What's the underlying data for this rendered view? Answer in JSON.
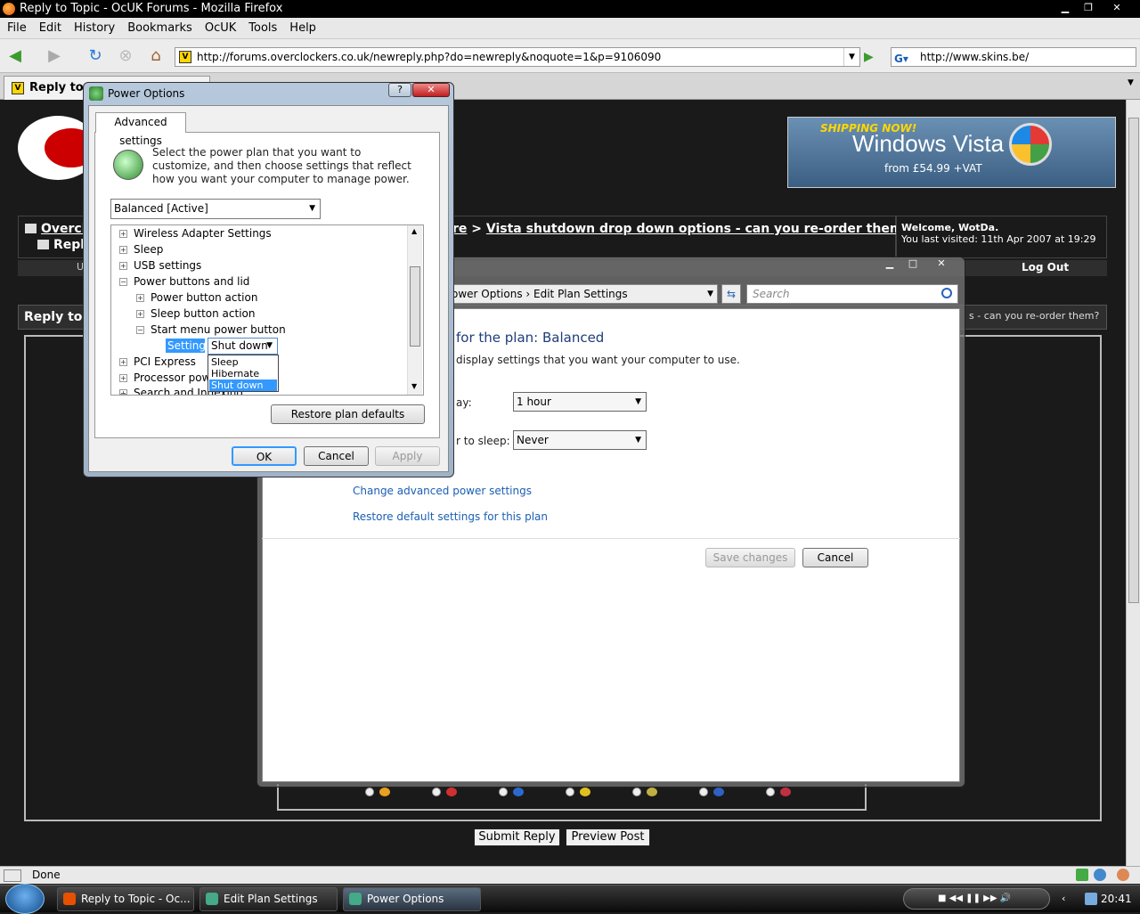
{
  "firefox": {
    "title": "Reply to Topic - OcUK Forums - Mozilla Firefox",
    "menu": [
      "File",
      "Edit",
      "History",
      "Bookmarks",
      "OcUK",
      "Tools",
      "Help"
    ],
    "url": "http://forums.overclockers.co.uk/newreply.php?do=newreply&noquote=1&p=9106090",
    "search_value": "http://www.skins.be/",
    "tab_label": "Reply to To",
    "status": "Done"
  },
  "page": {
    "banner": {
      "line1": "SHIPPING NOW!",
      "line2": "Windows Vista",
      "line3": "from £54.99 +VAT"
    },
    "breadcrumb1": "Overcl",
    "breadcrumb2": "Repl",
    "thread_prefix": "re",
    "thread_title": "Vista shutdown drop down options - can you re-order them?",
    "welcome_line1": "Welcome, WotDa.",
    "welcome_line2": "You last visited: 11th Apr 2007 at 19:29",
    "nav_u": "U",
    "logout": "Log Out",
    "reply_header": "Reply to T",
    "reply_header_right": "s - can you re-order them?",
    "submit_reply": "Submit Reply",
    "preview_post": "Preview Post"
  },
  "edit_plan": {
    "address": "ower Options  ›  Edit Plan Settings",
    "search_placeholder": "Search",
    "heading": "for the plan: Balanced",
    "subheading": "display settings that you want your computer to use.",
    "label1": "ay:",
    "label2": "r to sleep:",
    "display_value": "1 hour",
    "sleep_value": "Never",
    "link_advanced": "Change advanced power settings",
    "link_restore": "Restore default settings for this plan",
    "save_changes": "Save changes",
    "cancel": "Cancel"
  },
  "power_options": {
    "title": "Power Options",
    "tab": "Advanced settings",
    "description": "Select the power plan that you want to customize, and then choose settings that reflect how you want your computer to manage power.",
    "plan": "Balanced [Active]",
    "tree": {
      "wireless": "Wireless Adapter Settings",
      "sleep": "Sleep",
      "usb": "USB settings",
      "power_buttons": "Power buttons and lid",
      "power_button_action": "Power button action",
      "sleep_button_action": "Sleep button action",
      "start_menu_button": "Start menu power button",
      "pci": "PCI Express",
      "processor": "Processor powe",
      "search": "Search and Indexing"
    },
    "setting_label": "Setting:",
    "setting_value": "Shut down",
    "dropdown_options": [
      "Sleep",
      "Hibernate",
      "Shut down"
    ],
    "restore_defaults": "Restore plan defaults",
    "ok": "OK",
    "cancel": "Cancel",
    "apply": "Apply"
  },
  "taskbar": {
    "items": [
      "Reply to Topic - Oc...",
      "Edit Plan Settings",
      "Power Options"
    ],
    "clock": "20:41"
  }
}
